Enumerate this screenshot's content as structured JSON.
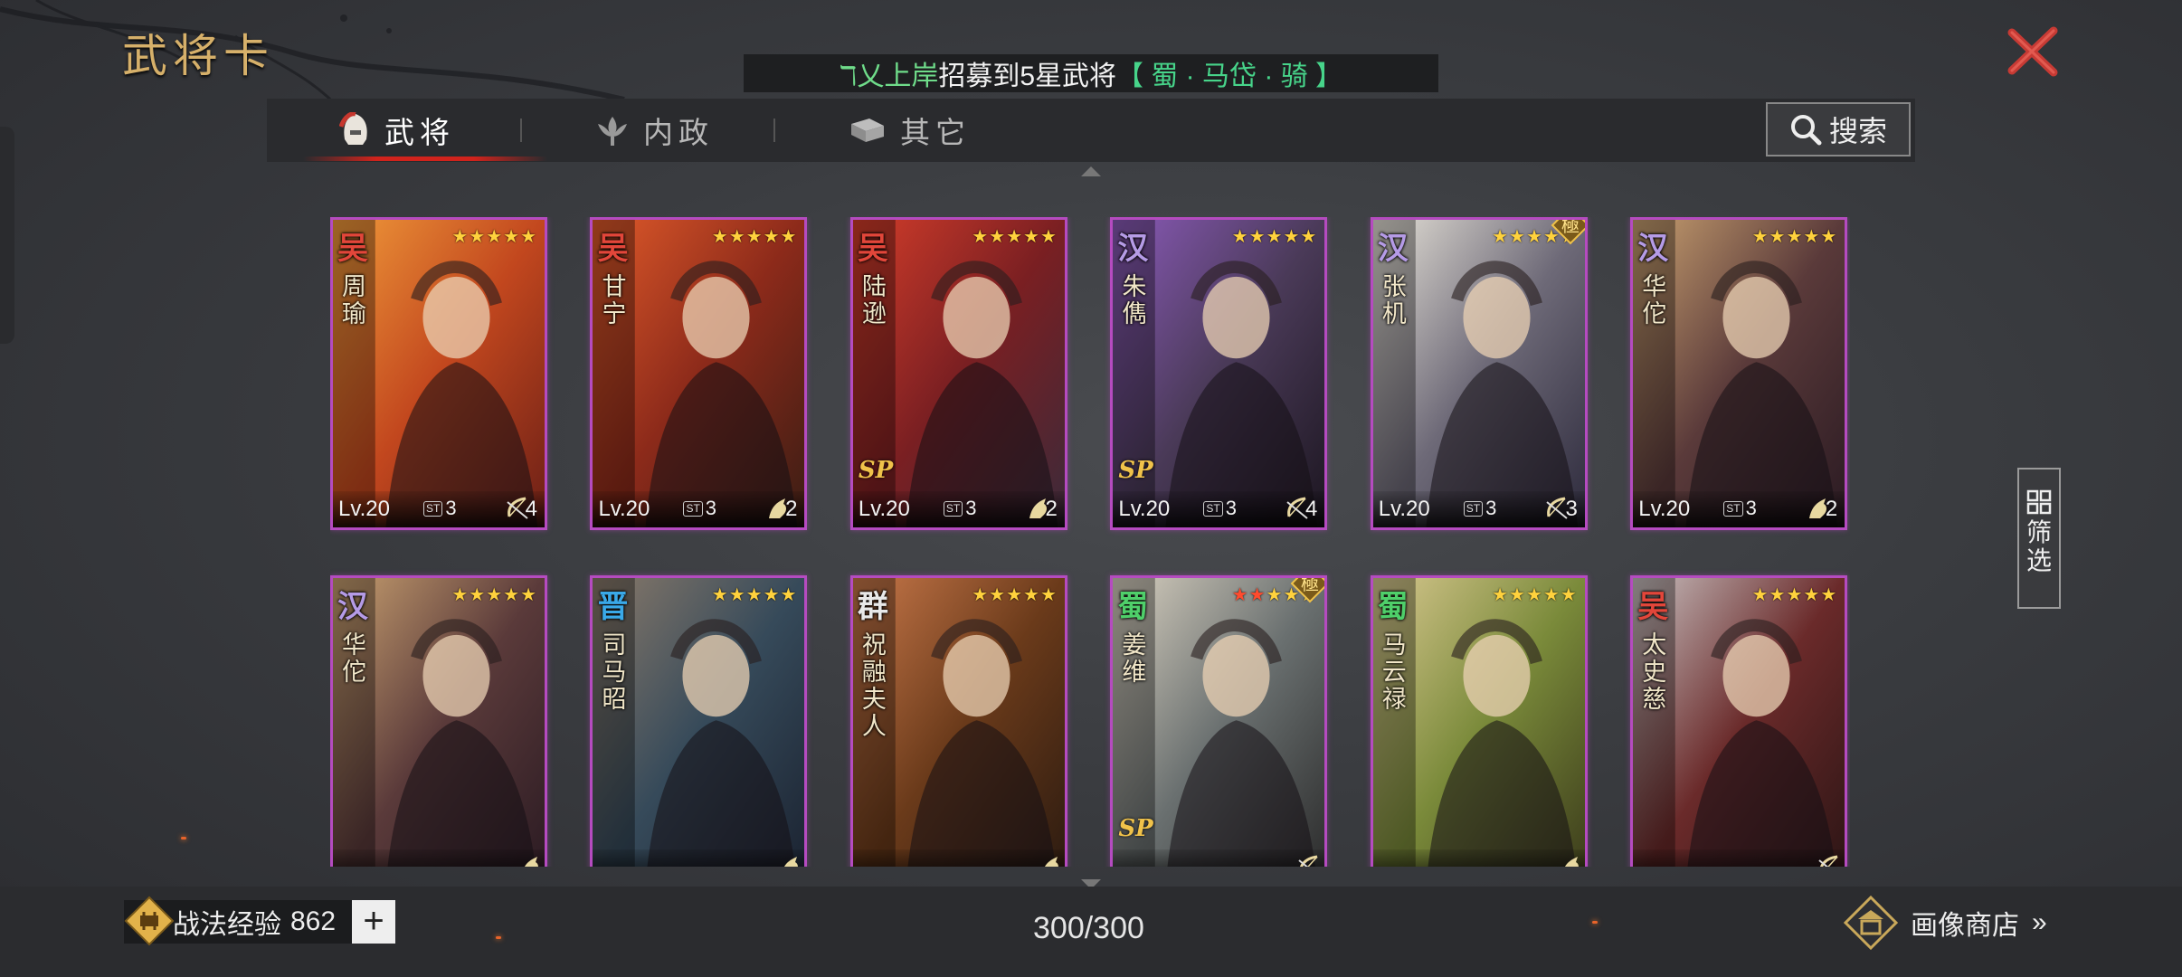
{
  "page_title": "武将卡",
  "ticker": {
    "user": "ℸ乂上岸",
    "message": "招募到5星武将",
    "hero": "【 蜀 · 马岱 · 骑 】"
  },
  "tabs": [
    {
      "label": "武将",
      "icon": "helmet-icon",
      "active": true
    },
    {
      "label": "内政",
      "icon": "lotus-icon",
      "active": false
    },
    {
      "label": "其它",
      "icon": "box-icon",
      "active": false
    }
  ],
  "search_label": "搜索",
  "filter_label": "筛选",
  "colors": {
    "wu": "#e2463a",
    "han": "#b59be6",
    "jin": "#3aa9e8",
    "qun": "#e8e8e8",
    "shu": "#4fcf6a",
    "card_border": "#b54bc0",
    "accent_red": "#d0231c"
  },
  "cards": [
    {
      "faction": "吴",
      "name": "周瑜",
      "level": "Lv.20",
      "cost": "3",
      "troop": "4",
      "troop_icon": "bow-icon",
      "stars": 5,
      "red_stars": 0,
      "extreme": false,
      "sp": ""
    },
    {
      "faction": "吴",
      "name": "甘宁",
      "level": "Lv.20",
      "cost": "3",
      "troop": "2",
      "troop_icon": "horse-icon",
      "stars": 5,
      "red_stars": 0,
      "extreme": false,
      "sp": ""
    },
    {
      "faction": "吴",
      "name": "陆逊",
      "level": "Lv.20",
      "cost": "3",
      "troop": "2",
      "troop_icon": "horse-icon",
      "stars": 5,
      "red_stars": 0,
      "extreme": false,
      "sp": "SP"
    },
    {
      "faction": "汉",
      "name": "朱儁",
      "level": "Lv.20",
      "cost": "3",
      "troop": "4",
      "troop_icon": "bow-icon",
      "stars": 5,
      "red_stars": 0,
      "extreme": false,
      "sp": "SP"
    },
    {
      "faction": "汉",
      "name": "张机",
      "level": "Lv.20",
      "cost": "3",
      "troop": "3",
      "troop_icon": "bow-icon",
      "stars": 5,
      "red_stars": 0,
      "extreme": true,
      "sp": ""
    },
    {
      "faction": "汉",
      "name": "华佗",
      "level": "Lv.20",
      "cost": "3",
      "troop": "2",
      "troop_icon": "horse-icon",
      "stars": 5,
      "red_stars": 0,
      "extreme": false,
      "sp": ""
    },
    {
      "faction": "汉",
      "name": "华佗",
      "level": "",
      "cost": "",
      "troop": "",
      "troop_icon": "horse-icon",
      "stars": 5,
      "red_stars": 0,
      "extreme": false,
      "sp": ""
    },
    {
      "faction": "晋",
      "name": "司马昭",
      "level": "",
      "cost": "",
      "troop": "",
      "troop_icon": "horse-icon",
      "stars": 5,
      "red_stars": 0,
      "extreme": false,
      "sp": ""
    },
    {
      "faction": "群",
      "name": "祝融夫人",
      "level": "",
      "cost": "",
      "troop": "",
      "troop_icon": "horse-icon",
      "stars": 5,
      "red_stars": 0,
      "extreme": false,
      "sp": ""
    },
    {
      "faction": "蜀",
      "name": "姜维",
      "level": "",
      "cost": "",
      "troop": "",
      "troop_icon": "bow-icon",
      "stars": 5,
      "red_stars": 2,
      "extreme": true,
      "sp": "SP"
    },
    {
      "faction": "蜀",
      "name": "马云禄",
      "level": "",
      "cost": "",
      "troop": "",
      "troop_icon": "horse-icon",
      "stars": 5,
      "red_stars": 0,
      "extreme": false,
      "sp": ""
    },
    {
      "faction": "吴",
      "name": "太史慈",
      "level": "",
      "cost": "",
      "troop": "",
      "troop_icon": "bow-icon",
      "stars": 5,
      "red_stars": 0,
      "extreme": false,
      "sp": ""
    }
  ],
  "footer": {
    "skill_exp_label": "战法经验",
    "skill_exp_value": "862",
    "plus": "+",
    "count": "300/300",
    "shop_label": "画像商店",
    "shop_arrow": "»"
  },
  "extreme_glyph": "極",
  "cost_icon_text": "ST"
}
